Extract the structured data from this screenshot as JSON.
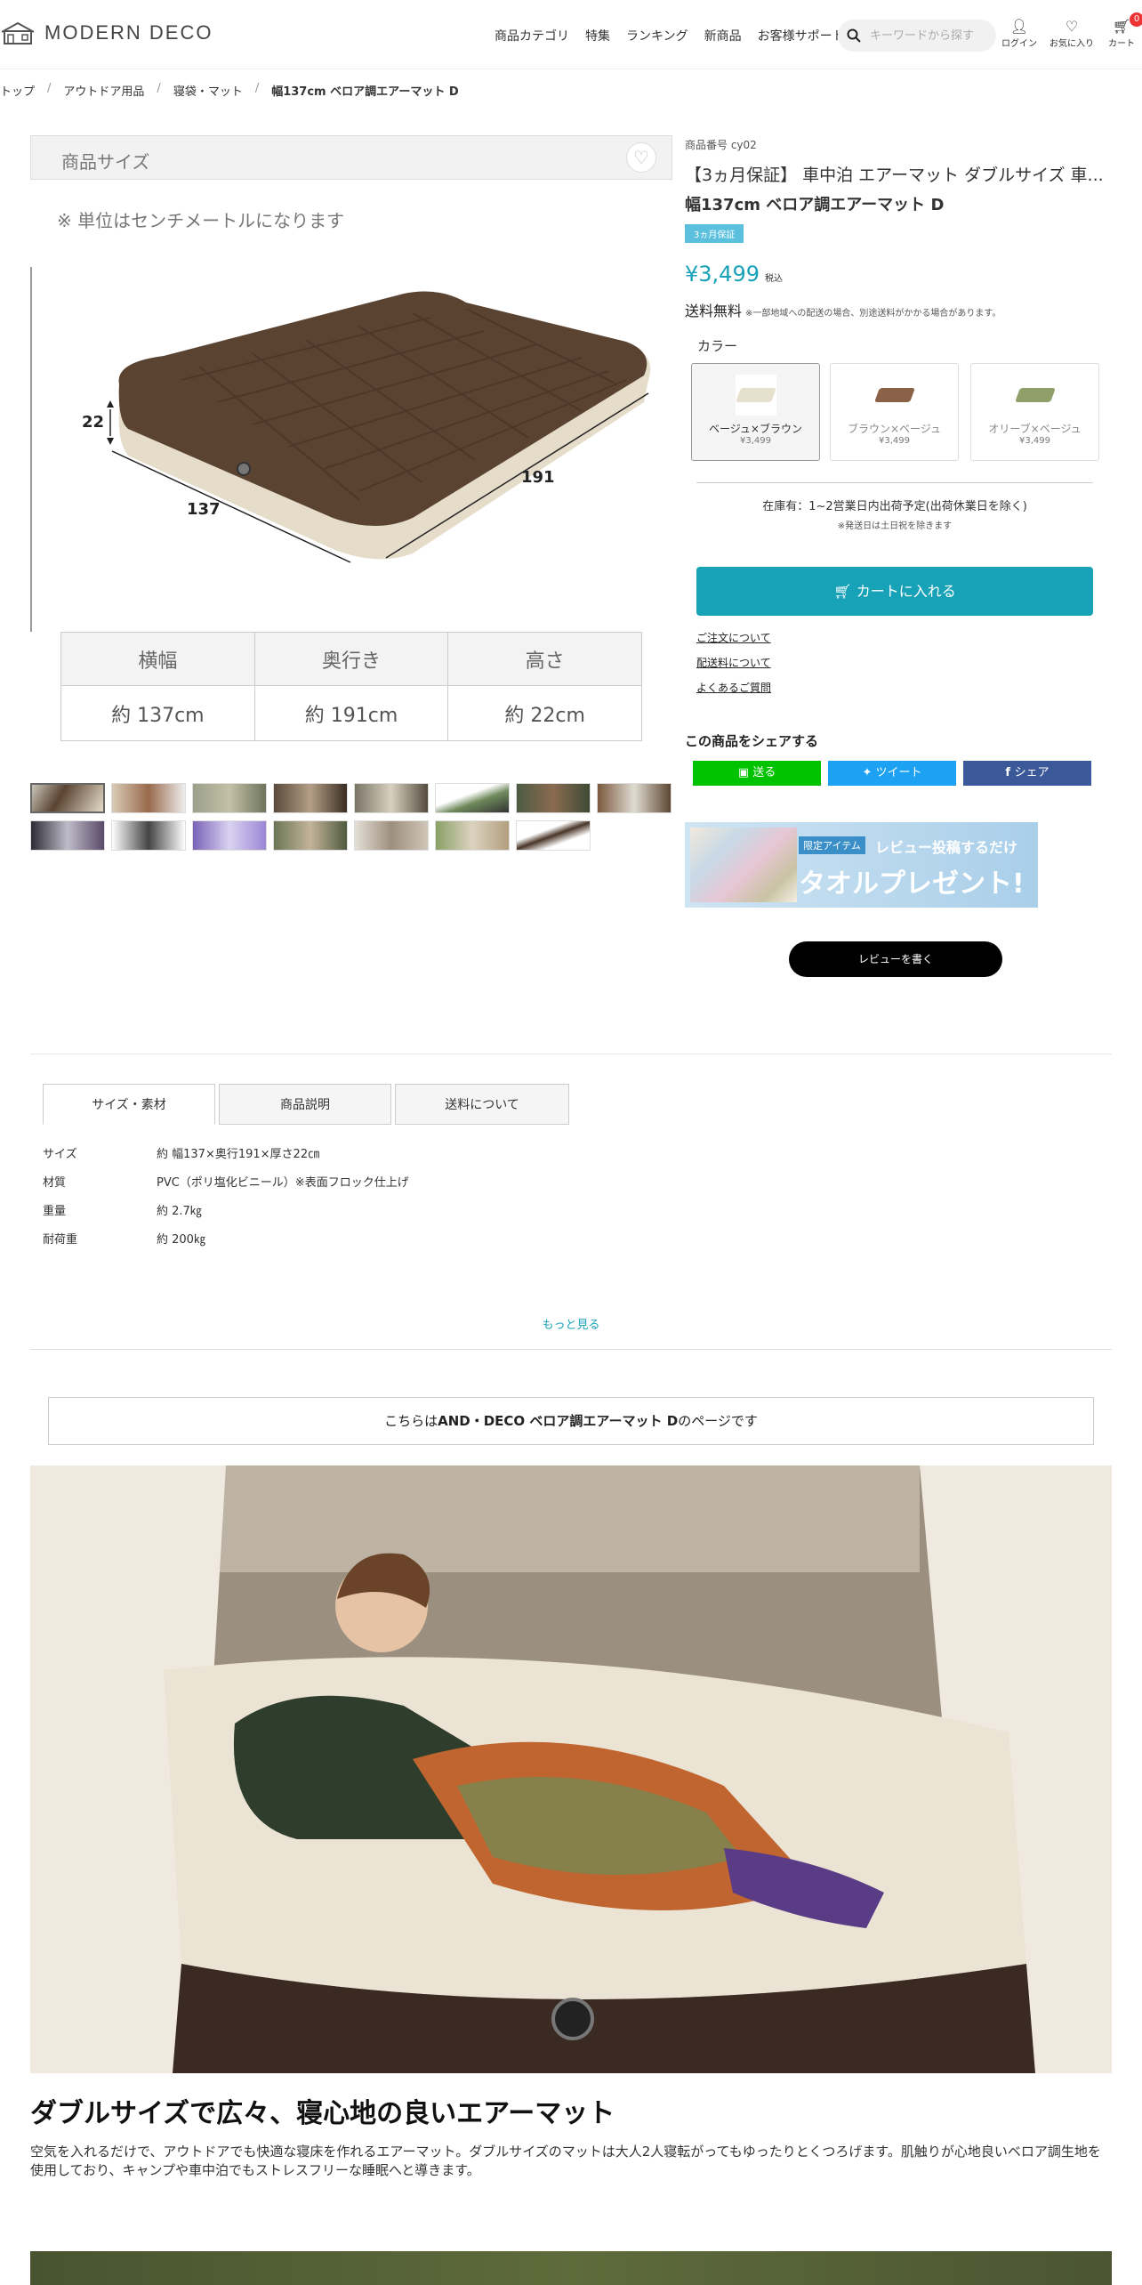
{
  "header": {
    "logo": "MODERN DECO",
    "nav": [
      "商品カテゴリ",
      "特集",
      "ランキング",
      "新商品",
      "お客様サポート"
    ],
    "search_placeholder": "キーワードから探す",
    "login": "ログイン",
    "favorites": "お気に入り",
    "cart": "カート",
    "cart_count": "0"
  },
  "breadcrumb": [
    "トップ",
    "アウトドア用品",
    "寝袋・マット",
    "幅137cm ベロア調エアーマット D"
  ],
  "image_panel": {
    "heading": "商品サイズ",
    "unit_note": "※ 単位はセンチメートルになります",
    "dims": [
      "22",
      "137",
      "191"
    ],
    "table_head": [
      "横幅",
      "奥行き",
      "高さ"
    ],
    "table_values": [
      "約 137cm",
      "約 191cm",
      "約 22cm"
    ]
  },
  "product": {
    "number": "商品番号 cy02",
    "title": "【3ヵ月保証】 車中泊 エアーマット ダブルサイズ 車...",
    "subtitle": "幅137cm ベロア調エアーマット D",
    "badge": "3ヵ月保証",
    "price": "¥3,499",
    "tax": "税込",
    "shipping": "送料無料",
    "shipping_note": "※一部地域への配送の場合、別途送料がかかる場合があります。",
    "color_label": "カラー",
    "colors": [
      {
        "name": "ベージュ×ブラウン",
        "price": "¥3,499",
        "swatch": "#e6e0cf"
      },
      {
        "name": "ブラウン×ベージュ",
        "price": "¥3,499",
        "swatch": "#8b6248"
      },
      {
        "name": "オリーブ×ベージュ",
        "price": "¥3,499",
        "swatch": "#8fa06b"
      }
    ],
    "stock": "在庫有：1~2営業日内出荷予定(出荷休業日を除く)",
    "stock_note": "※発送日は土日祝を除きます",
    "add_to_cart": "カートに入れる",
    "links": [
      "ご注文について",
      "配送料について",
      "よくあるご質問"
    ],
    "share_title": "この商品をシェアする",
    "share": [
      "送る",
      "ツイート",
      "シェア"
    ],
    "promo_tag": "限定アイテム",
    "promo_text1": "レビュー投稿するだけ",
    "promo_text2": "タオルプレゼント!",
    "review_button": "レビューを書く"
  },
  "tabs": [
    "サイズ・素材",
    "商品説明",
    "送料について"
  ],
  "specs": [
    {
      "label": "サイズ",
      "value": "約 幅137×奥行191×厚さ22㎝"
    },
    {
      "label": "材質",
      "value": "PVC（ポリ塩化ビニール）※表面フロック仕上げ"
    },
    {
      "label": "重量",
      "value": "約 2.7㎏"
    },
    {
      "label": "耐荷重",
      "value": "約 200㎏"
    }
  ],
  "more": "もっと見る",
  "brand_notice_pre": "こちらは",
  "brand_notice_bold": "AND・DECO ベロア調エアーマット D",
  "brand_notice_post": "のページです",
  "feature": {
    "heading": "ダブルサイズで広々、寝心地の良いエアーマット",
    "body": "空気を入れるだけで、アウトドアでも快適な寝床を作れるエアーマット。ダブルサイズのマットは大人2人寝転がってもゆったりとくつろげます。肌触りが心地良いベロア調生地を使用しており、キャンプや車中泊でもストレスフリーな睡眠へと導きます。"
  }
}
